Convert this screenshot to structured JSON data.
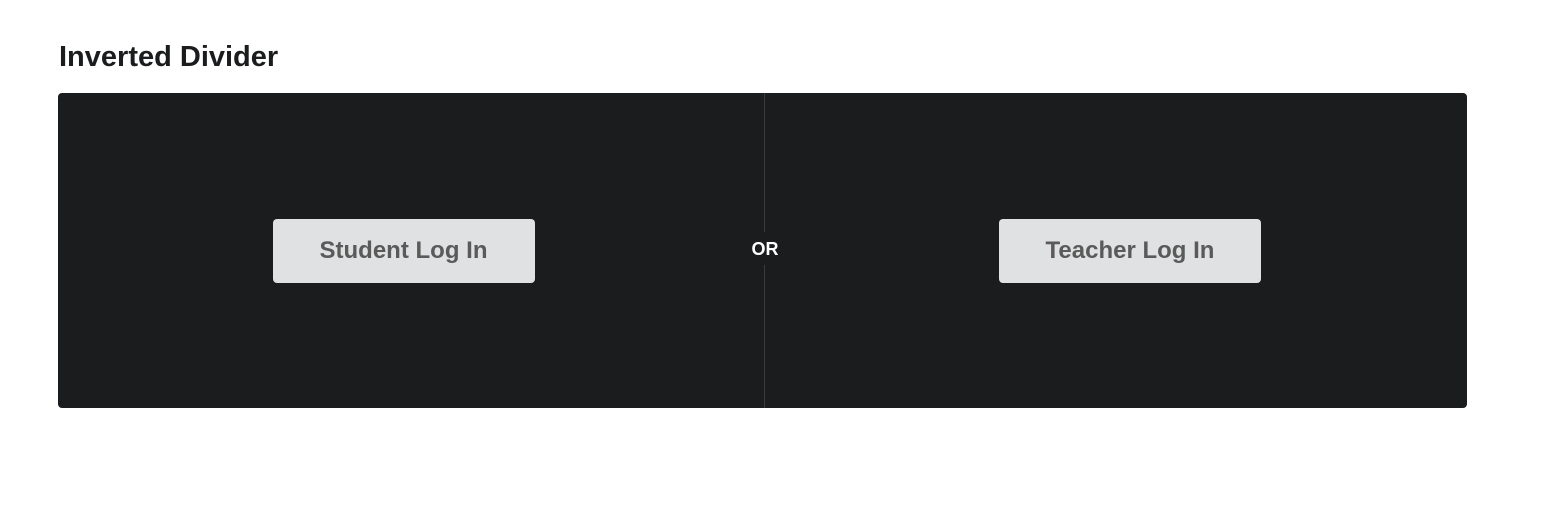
{
  "section": {
    "title": "Inverted Divider"
  },
  "segment": {
    "student_button_label": "Student Log In",
    "divider_label": "OR",
    "teacher_button_label": "Teacher Log In"
  },
  "colors": {
    "background": "#ffffff",
    "segment_background": "#1b1c1d",
    "button_background": "#e0e1e2",
    "button_text": "#5a5a5a",
    "divider_text": "#ffffff"
  }
}
